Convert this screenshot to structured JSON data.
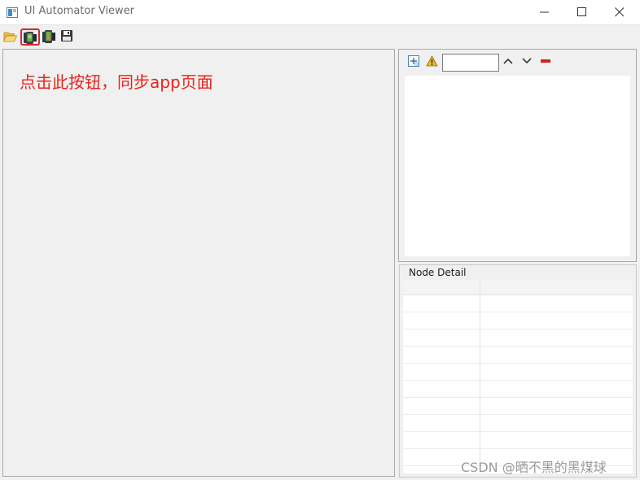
{
  "window": {
    "title": "UI Automator Viewer",
    "app_icon": "window-app-icon",
    "controls": [
      "minimize-icon",
      "maximize-icon",
      "close-icon"
    ]
  },
  "toolbar": {
    "items": [
      {
        "icon": "folder-open-icon"
      },
      {
        "icon": "device-screenshot-icon",
        "highlighted": true,
        "highlight_color": "#e02424"
      },
      {
        "icon": "device-screenshot-compressed-icon"
      },
      {
        "icon": "save-icon"
      }
    ]
  },
  "screenshot_pane": {
    "annotation": "点击此按钮，同步app页面",
    "annotation_color": "#e8241c"
  },
  "tree_pane": {
    "toolbar_icons": [
      "expand-all-icon",
      "warning-icon",
      "arrow-up-icon",
      "arrow-down-icon",
      "clear-icon"
    ],
    "search": {
      "value": "",
      "placeholder": ""
    }
  },
  "node_detail": {
    "title": "Node Detail",
    "rows": 11
  },
  "watermark": "CSDN @晒不黑的黑煤球",
  "colors": {
    "accent_red": "#e02424",
    "background": "#f0f0f0"
  }
}
